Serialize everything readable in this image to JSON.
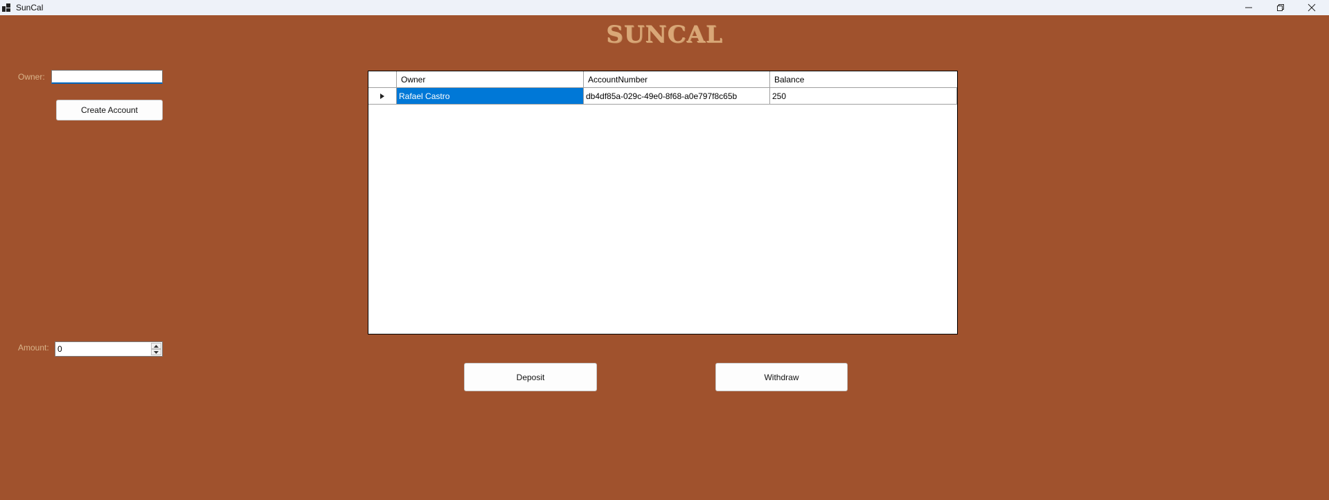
{
  "window": {
    "title": "SunCal",
    "icon": "app-window-icon",
    "controls": [
      "minimize-icon",
      "restore-icon",
      "close-icon"
    ]
  },
  "app_title": "SUNCAL",
  "colors": {
    "background": "#a0522d",
    "title": "#d9a777",
    "label": "#d9b48a",
    "selection": "#0078d7"
  },
  "form": {
    "owner_label": "Owner:",
    "owner_value": "",
    "create_button": "Create Account",
    "amount_label": "Amount:",
    "amount_value": "0"
  },
  "grid": {
    "columns": [
      "Owner",
      "AccountNumber",
      "Balance"
    ],
    "rows": [
      {
        "owner": "Rafael Castro",
        "account_number": "db4df85a-029c-49e0-8f68-a0e797f8c65b",
        "balance": "250",
        "selected": true
      }
    ]
  },
  "actions": {
    "deposit": "Deposit",
    "withdraw": "Withdraw"
  }
}
